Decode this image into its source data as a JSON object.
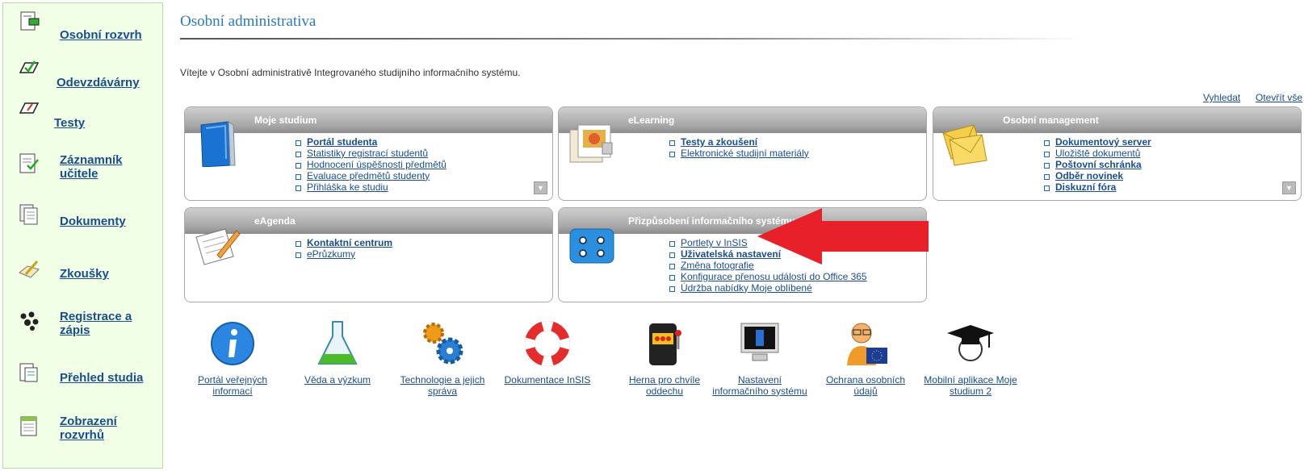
{
  "sidebar": {
    "items": [
      {
        "label": "Osobní rozvrh",
        "icon": "schedule-icon"
      },
      {
        "label": "Odevzdávárny",
        "icon": "dropbox-icon"
      },
      {
        "label": "Testy",
        "icon": "test-icon"
      },
      {
        "label": "Záznamník učitele",
        "icon": "notebook-icon"
      },
      {
        "label": "Dokumenty",
        "icon": "documents-icon"
      },
      {
        "label": "Zkoušky",
        "icon": "exam-icon"
      },
      {
        "label": "Registrace a zápis",
        "icon": "paw-icon"
      },
      {
        "label": "Přehled studia",
        "icon": "study-overview-icon"
      },
      {
        "label": "Zobrazení rozvrhů",
        "icon": "timetable-icon"
      }
    ]
  },
  "header": {
    "title": "Osobní administrativa",
    "welcome": "Vítejte v Osobní administrativě Integrovaného studijního informačního systému.",
    "search_link": "Vyhledat",
    "open_all_link": "Otevřít vše"
  },
  "portlets": [
    {
      "title": "Moje studium",
      "links": [
        {
          "label": "Portál studenta",
          "bold": true
        },
        {
          "label": "Statistiky registrací studentů",
          "bold": false
        },
        {
          "label": "Hodnocení úspěšnosti předmětů",
          "bold": false
        },
        {
          "label": "Evaluace předmětů studenty",
          "bold": false
        },
        {
          "label": "Přihláška ke studiu",
          "bold": false
        }
      ]
    },
    {
      "title": "eLearning",
      "links": [
        {
          "label": "Testy a zkoušení",
          "bold": true
        },
        {
          "label": "Elektronické studijní materiály",
          "bold": false
        }
      ]
    },
    {
      "title": "Osobní management",
      "links": [
        {
          "label": "Dokumentový server",
          "bold": true
        },
        {
          "label": "Uložiště dokumentů",
          "bold": false
        },
        {
          "label": "Poštovní schránka",
          "bold": true
        },
        {
          "label": "Odběr novinek",
          "bold": true
        },
        {
          "label": "Diskuzní fóra",
          "bold": true
        }
      ]
    },
    {
      "title": "eAgenda",
      "links": [
        {
          "label": "Kontaktní centrum",
          "bold": true
        },
        {
          "label": "ePrůzkumy",
          "bold": false
        }
      ]
    },
    {
      "title": "Přizpůsobení informačního systému",
      "links": [
        {
          "label": "Portlety v InSIS",
          "bold": false
        },
        {
          "label": "Uživatelská nastavení",
          "bold": true
        },
        {
          "label": "Změna fotografie",
          "bold": false
        },
        {
          "label": "Konfigurace přenosu událostí do Office 365",
          "bold": false
        },
        {
          "label": "Údržba nabídky Moje oblíbené",
          "bold": false
        }
      ]
    }
  ],
  "quick_links": [
    {
      "label": "Portál veřejných informací",
      "icon": "info-icon"
    },
    {
      "label": "Věda a výzkum",
      "icon": "flask-icon"
    },
    {
      "label": "Technologie a jejich správa",
      "icon": "gears-icon"
    },
    {
      "label": "Dokumentace InSIS",
      "icon": "lifebuoy-icon"
    },
    {
      "label": "Herna pro chvíle oddechu",
      "icon": "slot-machine-icon"
    },
    {
      "label": "Nastavení informačního systému",
      "icon": "monitor-icon"
    },
    {
      "label": "Ochrana osobních údajů",
      "icon": "gdpr-person-icon"
    },
    {
      "label": "Mobilní aplikace Moje studium 2",
      "icon": "graduation-cap-icon"
    }
  ],
  "colors": {
    "accent": "#2b7ab8",
    "link": "#1a4d8f",
    "sidebar_bg": "#f1ffe6",
    "arrow": "#e8202a"
  }
}
